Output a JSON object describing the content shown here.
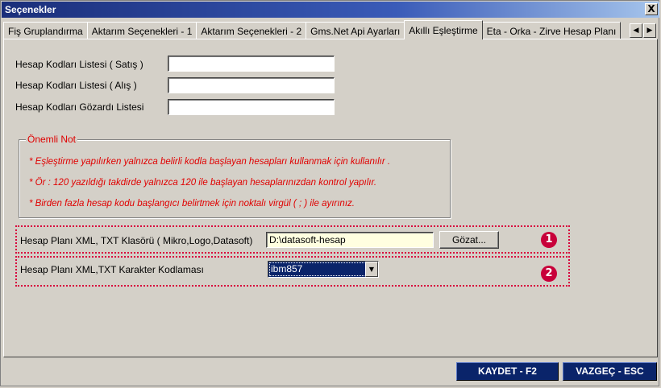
{
  "window": {
    "title": "Seçenekler",
    "close_label": "X"
  },
  "tabs": [
    {
      "label": "Fiş Gruplandırma",
      "active": false
    },
    {
      "label": "Aktarım Seçenekleri - 1",
      "active": false
    },
    {
      "label": "Aktarım Seçenekleri - 2",
      "active": false
    },
    {
      "label": "Gms.Net Api Ayarları",
      "active": false
    },
    {
      "label": "Akıllı Eşleştirme",
      "active": true
    },
    {
      "label": "Eta - Orka - Zirve Hesap Planı",
      "active": false
    }
  ],
  "tab_scroll": {
    "left": "◀",
    "right": "▶"
  },
  "form": {
    "satis_label": "Hesap Kodları Listesi ( Satış )",
    "satis_value": "",
    "alis_label": "Hesap Kodları Listesi ( Alış )",
    "alis_value": "",
    "gozardi_label": "Hesap Kodları Gözardı Listesi",
    "gozardi_value": ""
  },
  "note_box": {
    "title": "Önemli Not",
    "lines": [
      "* Eşleştirme yapılırken yalnızca belirli kodla başlayan hesapları kullanmak için kullanılır .",
      "* Ör : 120 yazıldığı takdirde yalnızca 120 ile başlayan hesaplarınızdan kontrol yapılır.",
      "* Birden fazla hesap kodu başlangıcı belirtmek için noktalı virgül ( ; ) ile ayırınız."
    ]
  },
  "folder_row": {
    "label": "Hesap Planı XML, TXT Klasörü ( Mikro,Logo,Datasoft)",
    "value": "D:\\datasoft-hesap",
    "browse_label": "Gözat...",
    "badge": "1"
  },
  "encoding_row": {
    "label": "Hesap Planı XML,TXT Karakter Kodlaması",
    "selected": "ibm857",
    "badge": "2"
  },
  "footer": {
    "save_label": "KAYDET - F2",
    "cancel_label": "VAZGEÇ - ESC"
  },
  "colors": {
    "accent": "#0a246a",
    "note_red": "#e00000",
    "highlight": "#d8003c"
  }
}
